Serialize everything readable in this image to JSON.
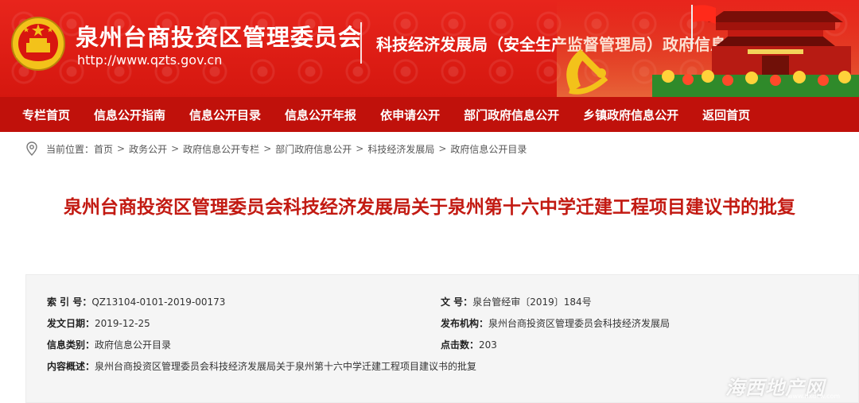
{
  "header": {
    "site_title": "泉州台商投资区管理委员会",
    "site_url": "http://www.qzts.gov.cn",
    "column_title": "科技经济发展局（安全生产监督管理局）政府信息公开专栏"
  },
  "nav": {
    "items": [
      "专栏首页",
      "信息公开指南",
      "信息公开目录",
      "信息公开年报",
      "依申请公开",
      "部门政府信息公开",
      "乡镇政府信息公开",
      "返回首页"
    ]
  },
  "breadcrumb": {
    "prefix": "当前位置：",
    "items": [
      "首页",
      "政务公开",
      "政府信息公开专栏",
      "部门政府信息公开",
      "科技经济发展局",
      "政府信息公开目录"
    ],
    "separator": ">"
  },
  "article": {
    "title": "泉州台商投资区管理委员会科技经济发展局关于泉州第十六中学迁建工程项目建议书的批复"
  },
  "info": {
    "index_label": "索 引 号：",
    "index_value": "QZ13104-0101-2019-00173",
    "doc_no_label": "文 号：",
    "doc_no_value": "泉台管经审〔2019〕184号",
    "date_label": "发文日期：",
    "date_value": "2019-12-25",
    "publisher_label": "发布机构：",
    "publisher_value": "泉州台商投资区管理委员会科技经济发展局",
    "category_label": "信息类别：",
    "category_value": "政府信息公开目录",
    "clicks_label": "点击数：",
    "clicks_value": "203",
    "summary_label": "内容概述：",
    "summary_value": "泉州台商投资区管理委员会科技经济发展局关于泉州第十六中学迁建工程项目建议书的批复"
  },
  "watermark": {
    "text": "海西地产网",
    "url": "www.hxdcw.com"
  },
  "colors": {
    "banner_red": "#d5170f",
    "nav_red": "#c0110b",
    "title_red": "#c21a12",
    "info_bg": "#f5f5f5"
  },
  "icons": {
    "emblem": "national-emblem-icon",
    "location": "location-pin-icon"
  }
}
